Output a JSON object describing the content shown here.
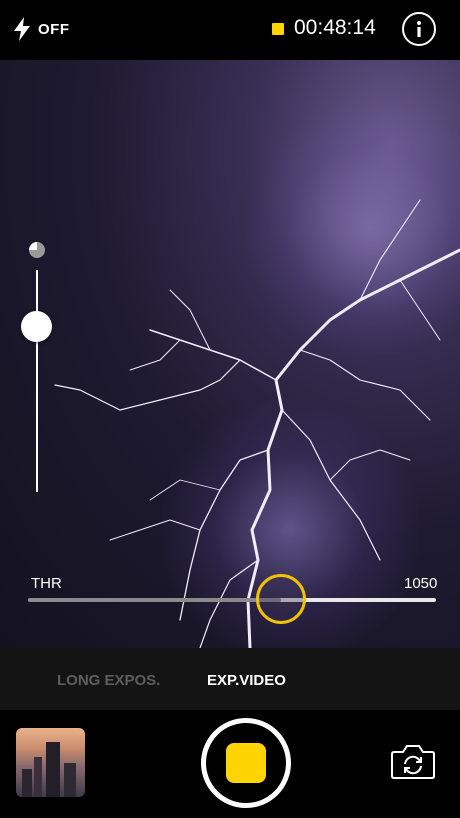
{
  "topbar": {
    "flash_icon": "lightning-bolt-icon",
    "flash_label": "OFF",
    "recording_indicator_color": "#ffd400",
    "timer": "00:48:14",
    "info_icon": "info-icon"
  },
  "viewfinder": {
    "exposure_icon": "exposure-icon",
    "threshold": {
      "label": "THR",
      "value": "1050",
      "position_fraction": 0.62
    },
    "exposure_level_fraction": 0.8
  },
  "modes": {
    "items": [
      "LONG EXPOS.",
      "EXP.VIDEO"
    ],
    "selected": "EXP.VIDEO"
  },
  "bottombar": {
    "gallery_icon": "gallery-thumbnail",
    "shutter_icon": "record-button",
    "flip_icon": "switch-camera-icon",
    "accent_color": "#ffd400"
  }
}
